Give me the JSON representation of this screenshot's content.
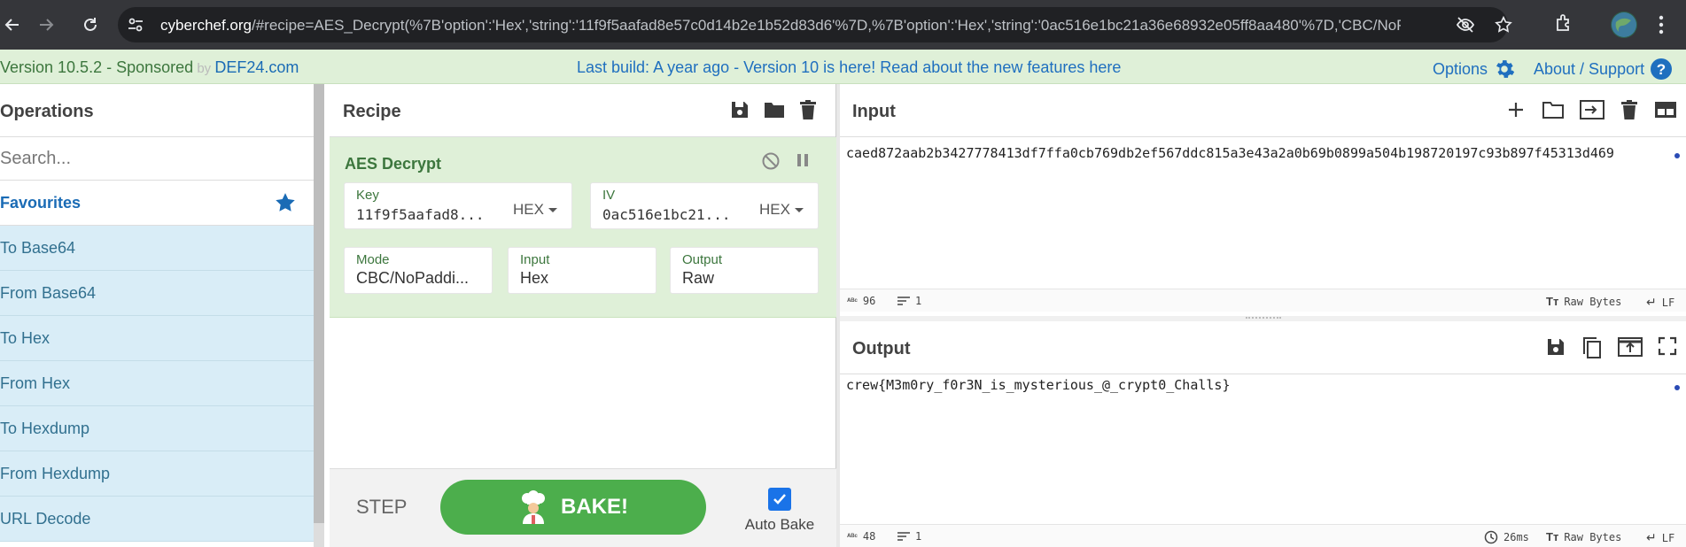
{
  "browser": {
    "url_domain": "cyberchef.org",
    "url_rest": "/#recipe=AES_Decrypt(%7B'option':'Hex','string':'11f9f5aafad8e57c0d14b2e1b52d83d6'%7D,%7B'option':'Hex','string':'0ac516e1bc21a36e68932e05ff8aa480'%7D,'CBC/NoPad...",
    "icons": [
      "back-icon",
      "forward-icon",
      "reload-icon",
      "tune-icon",
      "eye-off-icon",
      "star-icon",
      "extensions-icon",
      "profile-icon",
      "more-icon"
    ]
  },
  "banner": {
    "version": "Version 10.5.2",
    "sponsored": " - Sponsored",
    "by": " by ",
    "sponsor_link": "DEF24.com",
    "notice": "Last build: A year ago - Version 10 is here! Read about the new features here",
    "options": "Options",
    "about": "About / Support"
  },
  "operations": {
    "title": "Operations",
    "search_placeholder": "Search...",
    "favourites": "Favourites",
    "items": [
      "To Base64",
      "From Base64",
      "To Hex",
      "From Hex",
      "To Hexdump",
      "From Hexdump",
      "URL Decode"
    ]
  },
  "recipe": {
    "title": "Recipe",
    "operation": {
      "name": "AES Decrypt",
      "key_label": "Key",
      "key_value": "11f9f5aafad8...",
      "key_format": "HEX",
      "iv_label": "IV",
      "iv_value": "0ac516e1bc21...",
      "iv_format": "HEX",
      "mode_label": "Mode",
      "mode_value": "CBC/NoPaddi...",
      "input_label": "Input",
      "input_value": "Hex",
      "output_label": "Output",
      "output_value": "Raw"
    },
    "step": "STEP",
    "bake": "BAKE!",
    "auto_bake": "Auto Bake",
    "auto_bake_checked": true
  },
  "input": {
    "title": "Input",
    "text": "caed872aab2b3427778413df7ffa0cb769db2ef567ddc815a3e43a2a0b69b0899a504b198720197c93b897f45313d469",
    "length": "96",
    "lines": "1",
    "encoding": "Raw Bytes",
    "eol": "LF"
  },
  "output": {
    "title": "Output",
    "text": "crew{M3m0ry_f0r3N_is_mysterious_@_crypt0_Challs}",
    "length": "48",
    "lines": "1",
    "time": "26ms",
    "encoding": "Raw Bytes",
    "eol": "LF"
  },
  "colors": {
    "banner_bg": "#dff0d8",
    "op_bg": "#d9edf7",
    "recipe_op_bg": "#dff0d8",
    "bake_green": "#4cae4c",
    "link_blue": "#1f6fbf"
  }
}
